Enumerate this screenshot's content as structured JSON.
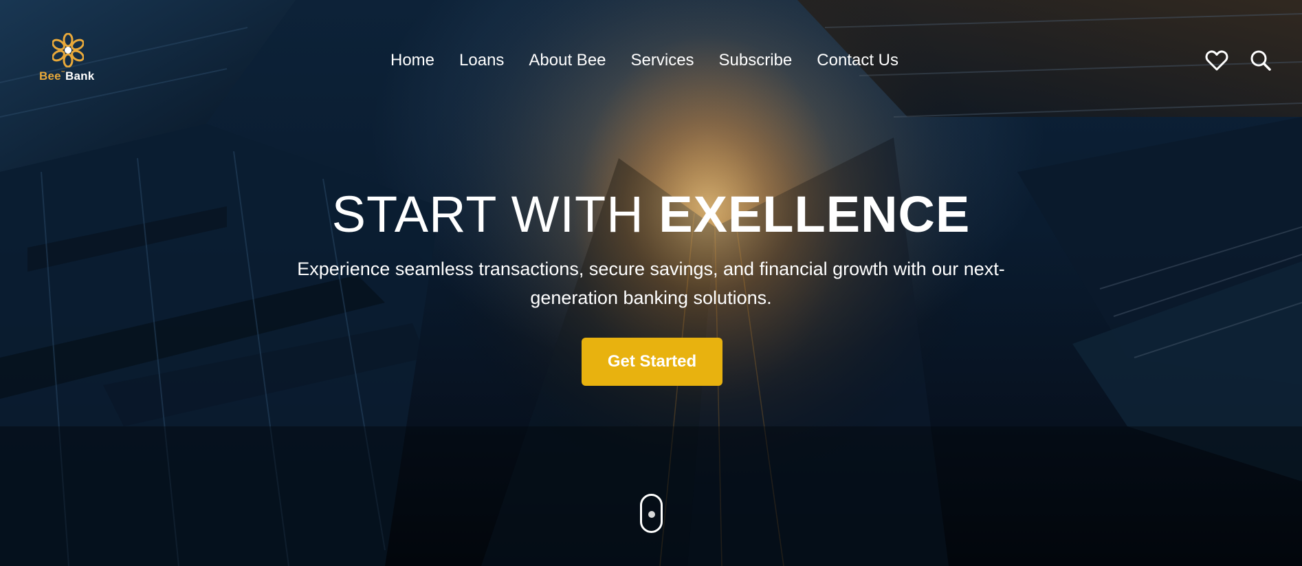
{
  "brand": {
    "name_part1": "Bee",
    "trademark": "™",
    "name_part2": "Bank",
    "logo_icon": "bee-flower-logo-icon",
    "accent_color": "#e9a93a"
  },
  "nav": {
    "items": [
      {
        "label": "Home"
      },
      {
        "label": "Loans"
      },
      {
        "label": "About Bee"
      },
      {
        "label": "Services"
      },
      {
        "label": "Subscribe"
      },
      {
        "label": "Contact Us"
      }
    ],
    "icons": [
      "heart-icon",
      "search-icon"
    ]
  },
  "hero": {
    "headline_light": "START WITH ",
    "headline_bold": "EXELLENCE",
    "subtext": "Experience seamless transactions, secure savings, and financial growth with our next-generation banking solutions.",
    "cta_label": "Get Started",
    "cta_color": "#e8b20f",
    "scroll_icon": "scroll-mouse-icon"
  }
}
